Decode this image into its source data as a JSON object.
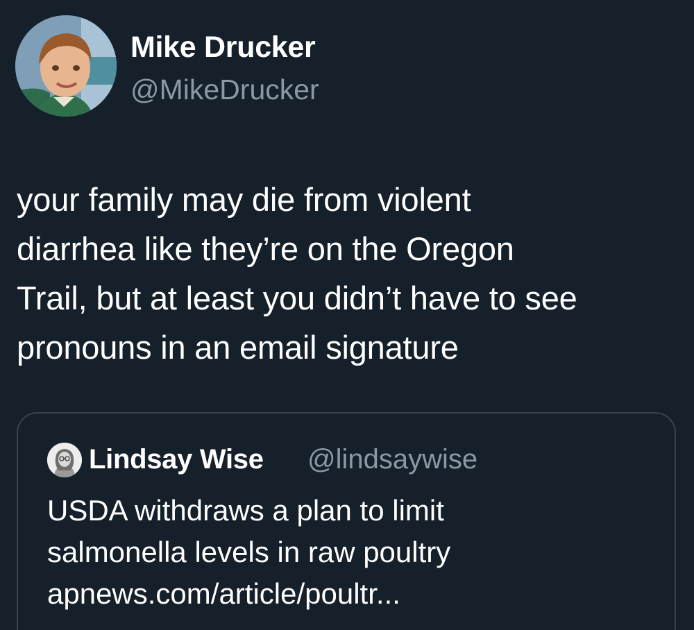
{
  "tweet": {
    "author": {
      "display_name": "Mike Drucker",
      "handle": "@MikeDrucker",
      "avatar_icon": "child-portrait-avatar"
    },
    "text_lines": [
      "your family may die from violent",
      "diarrhea like they’re on the Oregon",
      "Trail, but at least you didn’t have to see",
      "pronouns in an email signature"
    ]
  },
  "quoted_tweet": {
    "author": {
      "display_name": "Lindsay Wise",
      "handle": "@lindsaywise",
      "avatar_icon": "woman-portrait-avatar"
    },
    "text_lines": [
      "USDA withdraws a plan to limit",
      "salmonella levels in raw poultry"
    ],
    "link_text": "apnews.com/article/poultr..."
  },
  "colors": {
    "background": "#15202b",
    "primary_text": "#ffffff",
    "secondary_text": "#8b98a5",
    "card_border": "#38444d"
  }
}
